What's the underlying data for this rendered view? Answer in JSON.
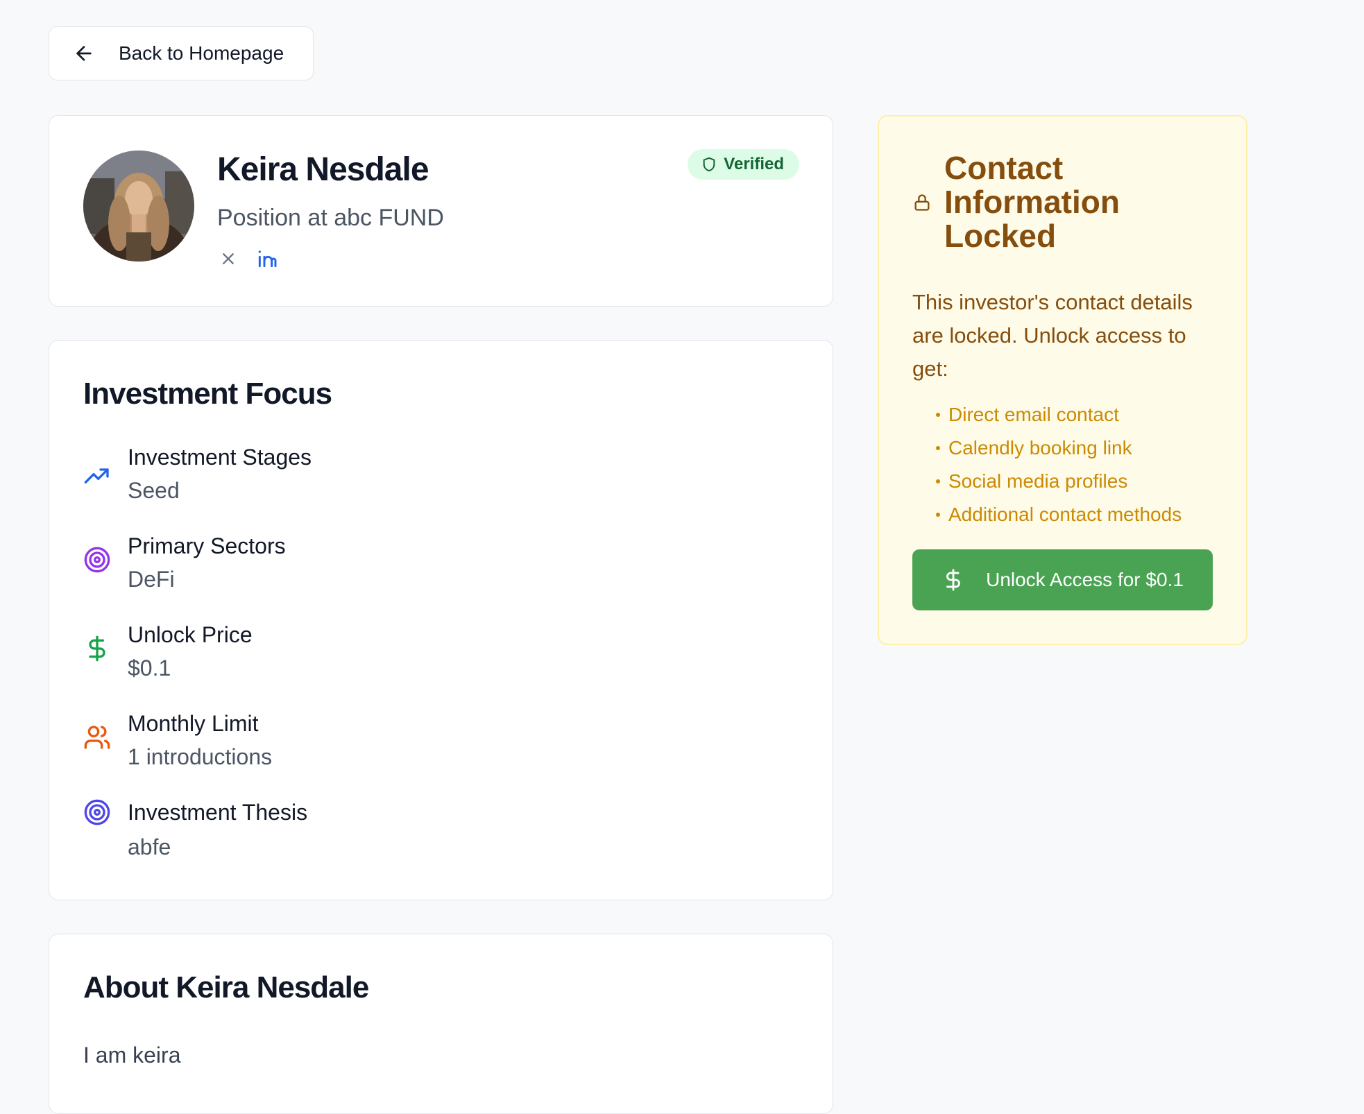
{
  "back": {
    "label": "Back to Homepage",
    "icon": "arrow-left-icon"
  },
  "profile": {
    "name": "Keira Nesdale",
    "position": "Position at abc FUND",
    "badge": "Verified",
    "socials": [
      {
        "icon": "x-twitter-icon"
      },
      {
        "icon": "linkedin-icon"
      }
    ]
  },
  "focus": {
    "title": "Investment Focus",
    "items": [
      {
        "label": "Investment Stages",
        "value": "Seed",
        "icon": "trending-up-icon",
        "color": "#2563eb"
      },
      {
        "label": "Primary Sectors",
        "value": "DeFi",
        "icon": "target-icon",
        "color": "#9333ea"
      },
      {
        "label": "Unlock Price",
        "value": "$0.1",
        "icon": "dollar-icon",
        "color": "#16a34a"
      },
      {
        "label": "Monthly Limit",
        "value": "1 introductions",
        "icon": "users-icon",
        "color": "#ea580c"
      },
      {
        "label": "Investment Thesis",
        "value": "abfe",
        "icon": "target-icon",
        "color": "#4f46e5"
      }
    ]
  },
  "about": {
    "title": "About Keira Nesdale",
    "text": "I am keira"
  },
  "contact": {
    "title": "Contact Information Locked",
    "description": "This investor's contact details are locked. Unlock access to get:",
    "benefits": [
      "Direct email contact",
      "Calendly booking link",
      "Social media profiles",
      "Additional contact methods"
    ],
    "unlock_label": "Unlock Access for $0.1"
  },
  "colors": {
    "page": "#f8f9fb",
    "verified_bg": "#dcfce7",
    "locked_bg": "#fefce8",
    "locked_text": "#854d0e",
    "button": "#4aa353"
  }
}
